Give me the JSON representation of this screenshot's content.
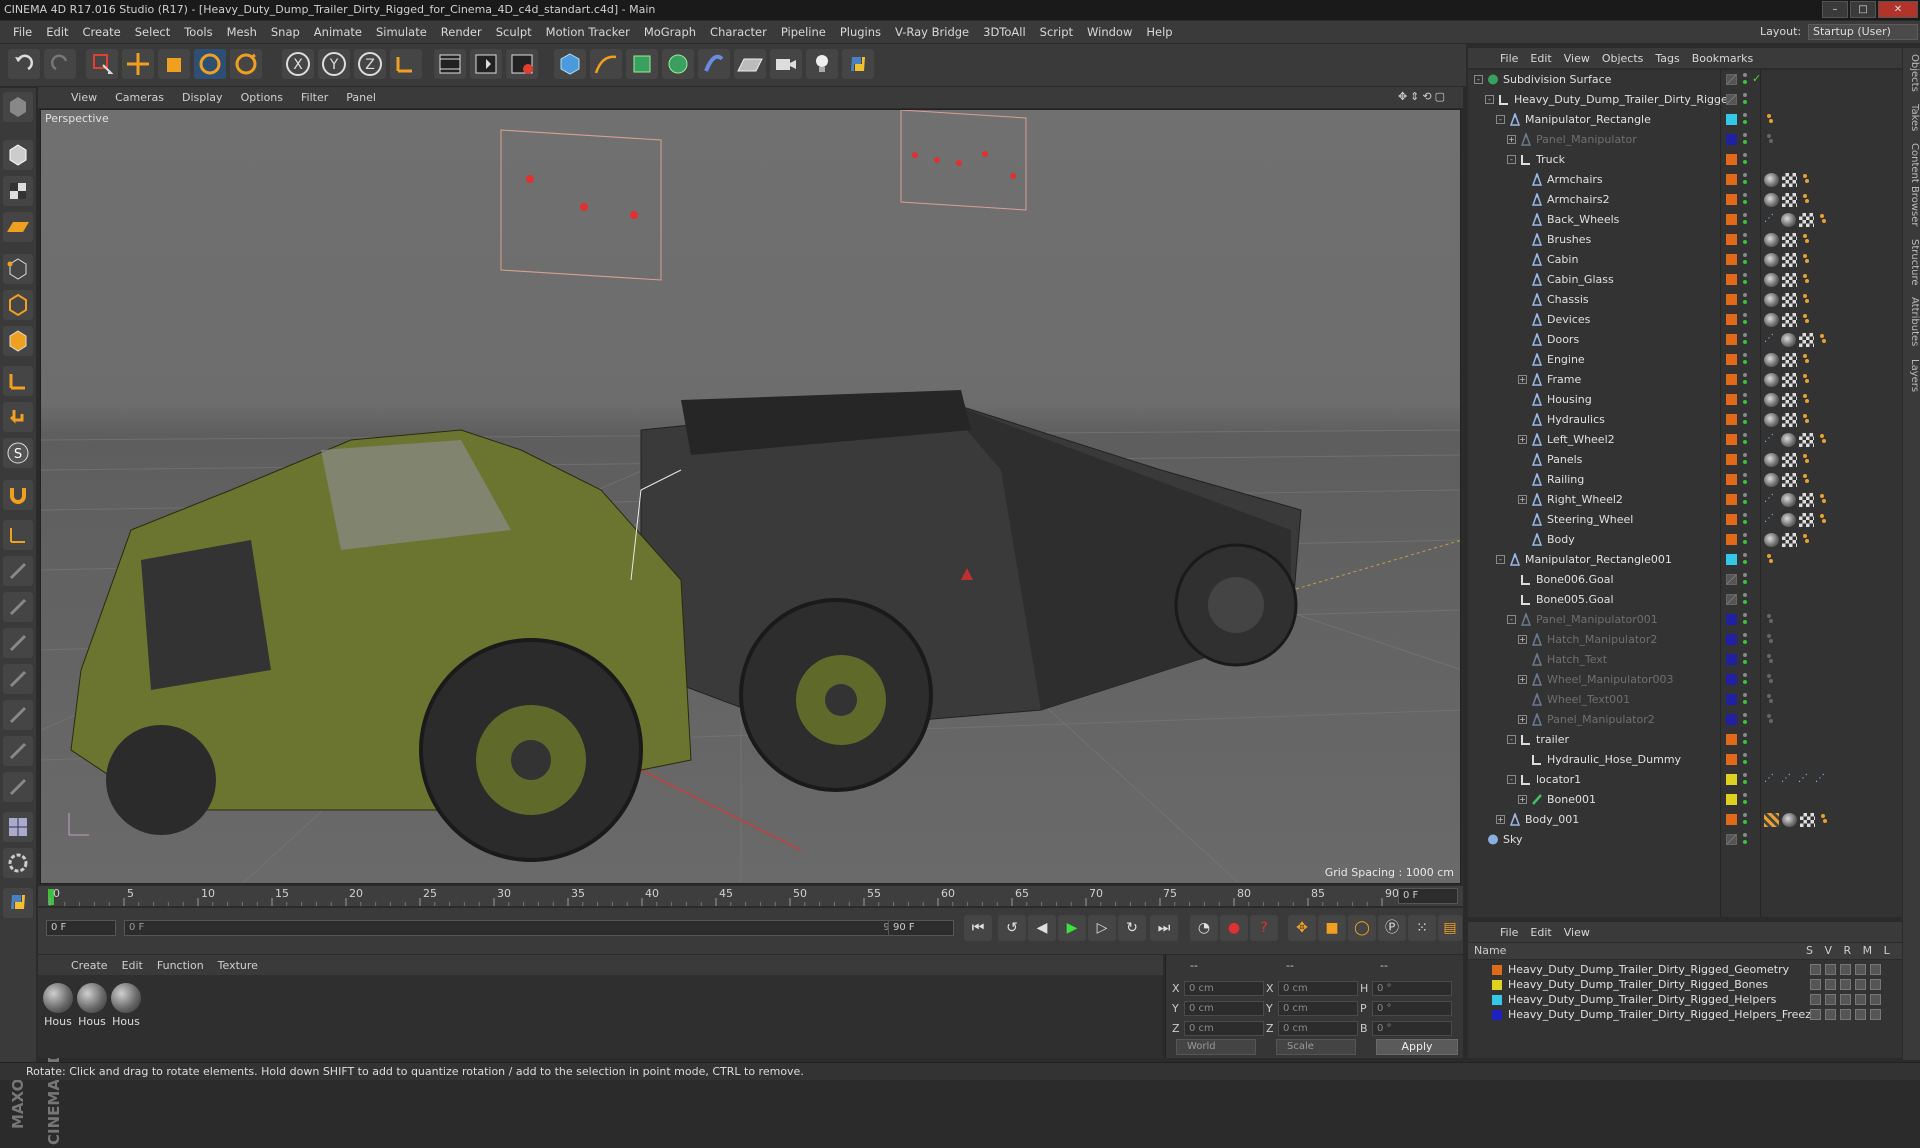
{
  "window": {
    "title": "CINEMA 4D R17.016 Studio (R17) - [Heavy_Duty_Dump_Trailer_Dirty_Rigged_for_Cinema_4D_c4d_standart.c4d] - Main"
  },
  "main_menu": [
    "File",
    "Edit",
    "Create",
    "Select",
    "Tools",
    "Mesh",
    "Snap",
    "Animate",
    "Simulate",
    "Render",
    "Sculpt",
    "Motion Tracker",
    "MoGraph",
    "Character",
    "Pipeline",
    "Plugins",
    "V-Ray Bridge",
    "3DToAll",
    "Script",
    "Window",
    "Help"
  ],
  "layout": {
    "label": "Layout:",
    "value": "Startup (User)"
  },
  "viewport": {
    "menu": [
      "View",
      "Cameras",
      "Display",
      "Options",
      "Filter",
      "Panel"
    ],
    "label": "Perspective",
    "grid_spacing": "Grid Spacing : 1000 cm"
  },
  "timeline": {
    "ticks": [
      "0",
      "5",
      "10",
      "15",
      "20",
      "25",
      "30",
      "35",
      "40",
      "45",
      "50",
      "55",
      "60",
      "65",
      "70",
      "75",
      "80",
      "85",
      "90"
    ],
    "current_frame": "0 F"
  },
  "transport": {
    "start_field": "0 F",
    "range_start": "0 F",
    "range_end": "90 F",
    "end_field": "90 F"
  },
  "materials": {
    "menu": [
      "Create",
      "Edit",
      "Function",
      "Texture"
    ],
    "items": [
      "Hous",
      "Hous",
      "Hous"
    ]
  },
  "coordinates": {
    "header_left": "--",
    "header_mid": "--",
    "header_right": "--",
    "rows": [
      {
        "l1": "X",
        "v1": "0 cm",
        "l2": "X",
        "v2": "0 cm",
        "l3": "H",
        "v3": "0 °"
      },
      {
        "l1": "Y",
        "v1": "0 cm",
        "l2": "Y",
        "v2": "0 cm",
        "l3": "P",
        "v3": "0 °"
      },
      {
        "l1": "Z",
        "v1": "0 cm",
        "l2": "Z",
        "v2": "0 cm",
        "l3": "B",
        "v3": "0 °"
      }
    ],
    "mode": "World",
    "scale": "Scale",
    "apply": "Apply"
  },
  "object_manager": {
    "menu": [
      "File",
      "Edit",
      "View",
      "Objects",
      "Tags",
      "Bookmarks"
    ],
    "objects": [
      {
        "name": "Subdivision Surface",
        "depth": 0,
        "exp": "-",
        "icon": "subdiv",
        "layer": "",
        "dim": false,
        "tags": ""
      },
      {
        "name": "Heavy_Duty_Dump_Trailer_Dirty_Rigged",
        "depth": 1,
        "exp": "-",
        "icon": "null",
        "layer": "",
        "dim": false,
        "tags": ""
      },
      {
        "name": "Manipulator_Rectangle",
        "depth": 2,
        "exp": "-",
        "icon": "joint",
        "layer": "#32c8e6",
        "dim": false,
        "tags": "o"
      },
      {
        "name": "Panel_Manipulator",
        "depth": 3,
        "exp": "+",
        "icon": "joint",
        "layer": "#2020a0",
        "dim": true,
        "tags": "g"
      },
      {
        "name": "Truck",
        "depth": 3,
        "exp": "-",
        "icon": "null",
        "layer": "#e06a1a",
        "dim": false,
        "tags": ""
      },
      {
        "name": "Armchairs",
        "depth": 4,
        "exp": "",
        "icon": "joint",
        "layer": "#e06a1a",
        "dim": false,
        "tags": "pco"
      },
      {
        "name": "Armchairs2",
        "depth": 4,
        "exp": "",
        "icon": "joint",
        "layer": "#e06a1a",
        "dim": false,
        "tags": "pco"
      },
      {
        "name": "Back_Wheels",
        "depth": 4,
        "exp": "",
        "icon": "joint",
        "layer": "#e06a1a",
        "dim": false,
        "tags": "bpco"
      },
      {
        "name": "Brushes",
        "depth": 4,
        "exp": "",
        "icon": "joint",
        "layer": "#e06a1a",
        "dim": false,
        "tags": "pco"
      },
      {
        "name": "Cabin",
        "depth": 4,
        "exp": "",
        "icon": "joint",
        "layer": "#e06a1a",
        "dim": false,
        "tags": "pco"
      },
      {
        "name": "Cabin_Glass",
        "depth": 4,
        "exp": "",
        "icon": "joint",
        "layer": "#e06a1a",
        "dim": false,
        "tags": "pco"
      },
      {
        "name": "Chassis",
        "depth": 4,
        "exp": "",
        "icon": "joint",
        "layer": "#e06a1a",
        "dim": false,
        "tags": "pco"
      },
      {
        "name": "Devices",
        "depth": 4,
        "exp": "",
        "icon": "joint",
        "layer": "#e06a1a",
        "dim": false,
        "tags": "pco"
      },
      {
        "name": "Doors",
        "depth": 4,
        "exp": "",
        "icon": "joint",
        "layer": "#e06a1a",
        "dim": false,
        "tags": "bpco"
      },
      {
        "name": "Engine",
        "depth": 4,
        "exp": "",
        "icon": "joint",
        "layer": "#e06a1a",
        "dim": false,
        "tags": "pco"
      },
      {
        "name": "Frame",
        "depth": 4,
        "exp": "+",
        "icon": "joint",
        "layer": "#e06a1a",
        "dim": false,
        "tags": "pco"
      },
      {
        "name": "Housing",
        "depth": 4,
        "exp": "",
        "icon": "joint",
        "layer": "#e06a1a",
        "dim": false,
        "tags": "pco"
      },
      {
        "name": "Hydraulics",
        "depth": 4,
        "exp": "",
        "icon": "joint",
        "layer": "#e06a1a",
        "dim": false,
        "tags": "pco"
      },
      {
        "name": "Left_Wheel2",
        "depth": 4,
        "exp": "+",
        "icon": "joint",
        "layer": "#e06a1a",
        "dim": false,
        "tags": "bpco"
      },
      {
        "name": "Panels",
        "depth": 4,
        "exp": "",
        "icon": "joint",
        "layer": "#e06a1a",
        "dim": false,
        "tags": "pco"
      },
      {
        "name": "Railing",
        "depth": 4,
        "exp": "",
        "icon": "joint",
        "layer": "#e06a1a",
        "dim": false,
        "tags": "pco"
      },
      {
        "name": "Right_Wheel2",
        "depth": 4,
        "exp": "+",
        "icon": "joint",
        "layer": "#e06a1a",
        "dim": false,
        "tags": "bpco"
      },
      {
        "name": "Steering_Wheel",
        "depth": 4,
        "exp": "",
        "icon": "joint",
        "layer": "#e06a1a",
        "dim": false,
        "tags": "bpco"
      },
      {
        "name": "Body",
        "depth": 4,
        "exp": "",
        "icon": "joint",
        "layer": "#e06a1a",
        "dim": false,
        "tags": "pco"
      },
      {
        "name": "Manipulator_Rectangle001",
        "depth": 2,
        "exp": "-",
        "icon": "joint",
        "layer": "#32c8e6",
        "dim": false,
        "tags": "o"
      },
      {
        "name": "Bone006.Goal",
        "depth": 3,
        "exp": "",
        "icon": "null",
        "layer": "",
        "dim": false,
        "tags": ""
      },
      {
        "name": "Bone005.Goal",
        "depth": 3,
        "exp": "",
        "icon": "null",
        "layer": "",
        "dim": false,
        "tags": ""
      },
      {
        "name": "Panel_Manipulator001",
        "depth": 3,
        "exp": "-",
        "icon": "joint",
        "layer": "#2020a0",
        "dim": true,
        "tags": "g"
      },
      {
        "name": "Hatch_Manipulator2",
        "depth": 4,
        "exp": "+",
        "icon": "joint",
        "layer": "#2020a0",
        "dim": true,
        "tags": "g"
      },
      {
        "name": "Hatch_Text",
        "depth": 4,
        "exp": "",
        "icon": "joint",
        "layer": "#2020a0",
        "dim": true,
        "tags": "g"
      },
      {
        "name": "Wheel_Manipulator003",
        "depth": 4,
        "exp": "+",
        "icon": "joint",
        "layer": "#2020a0",
        "dim": true,
        "tags": "g"
      },
      {
        "name": "Wheel_Text001",
        "depth": 4,
        "exp": "",
        "icon": "joint",
        "layer": "#2020a0",
        "dim": true,
        "tags": "g"
      },
      {
        "name": "Panel_Manipulator2",
        "depth": 4,
        "exp": "+",
        "icon": "joint",
        "layer": "#2020a0",
        "dim": true,
        "tags": "g"
      },
      {
        "name": "trailer",
        "depth": 3,
        "exp": "-",
        "icon": "null",
        "layer": "#e06a1a",
        "dim": false,
        "tags": ""
      },
      {
        "name": "Hydraulic_Hose_Dummy",
        "depth": 4,
        "exp": "",
        "icon": "null",
        "layer": "#e06a1a",
        "dim": false,
        "tags": ""
      },
      {
        "name": "locator1",
        "depth": 3,
        "exp": "-",
        "icon": "null",
        "layer": "#e0d020",
        "dim": false,
        "tags": "bbbb"
      },
      {
        "name": "Bone001",
        "depth": 4,
        "exp": "+",
        "icon": "bone",
        "layer": "#e0d020",
        "dim": false,
        "tags": ""
      },
      {
        "name": "Body_001",
        "depth": 2,
        "exp": "+",
        "icon": "joint",
        "layer": "#e06a1a",
        "dim": false,
        "tags": "xpco"
      },
      {
        "name": "Sky",
        "depth": 0,
        "exp": "",
        "icon": "sky",
        "layer": "",
        "dim": false,
        "tags": ""
      }
    ]
  },
  "layer_manager": {
    "menu": [
      "File",
      "Edit",
      "View"
    ],
    "name_header": "Name",
    "col_headers": "S V R M L",
    "layers": [
      {
        "name": "Heavy_Duty_Dump_Trailer_Dirty_Rigged_Geometry",
        "color": "#e06a1a"
      },
      {
        "name": "Heavy_Duty_Dump_Trailer_Dirty_Rigged_Bones",
        "color": "#e0d020"
      },
      {
        "name": "Heavy_Duty_Dump_Trailer_Dirty_Rigged_Helpers",
        "color": "#32c8e6"
      },
      {
        "name": "Heavy_Duty_Dump_Trailer_Dirty_Rigged_Helpers_Freeze",
        "color": "#2020c0"
      }
    ]
  },
  "right_tabs": [
    "Objects",
    "Takes",
    "Content Browser",
    "Structure",
    "Attributes",
    "Layers"
  ],
  "status": "Rotate: Click and drag to rotate elements. Hold down SHIFT to add to quantize rotation / add to the selection in point mode, CTRL to remove."
}
